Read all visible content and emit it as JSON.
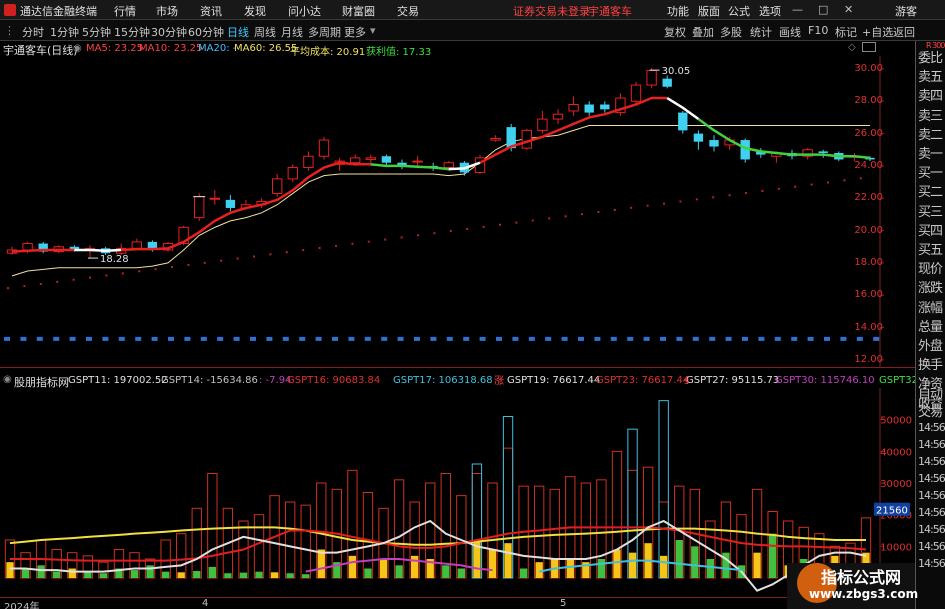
{
  "app": {
    "title": "通达信金融终端",
    "menus": [
      "行情",
      "市场",
      "资讯",
      "发现",
      "问小达",
      "财富圈",
      "交易"
    ],
    "status_msg": "证券交易未登录",
    "stock_tab": "宇通客车",
    "right_menus": [
      "功能",
      "版面",
      "公式",
      "选项"
    ],
    "user": "游客"
  },
  "toolbar": {
    "periods": [
      "分时",
      "1分钟",
      "5分钟",
      "15分钟",
      "30分钟",
      "60分钟",
      "日线",
      "周线",
      "月线",
      "多周期",
      "更多"
    ],
    "active_period": "日线",
    "right_tools": [
      "复权",
      "叠加",
      "多股",
      "统计",
      "画线",
      "F10",
      "标记",
      "+自选",
      "返回"
    ]
  },
  "main_info": {
    "stock": "宇通客车(日线)",
    "ma5": "MA5: 23.25",
    "ma10": "MA10: 23.25",
    "ma20": "MA20: -",
    "ma60": "MA60: 26.55",
    "avg_cost": "平均成本: 20.91",
    "profit": "获利值: 17.33"
  },
  "indicator_info": {
    "name": "股朋指标网",
    "items": [
      {
        "text": "GSPT11: 197002.52",
        "color": "#e0e0e0"
      },
      {
        "text": "GSPT14: -15634.86",
        "color": "#c0c0c0"
      },
      {
        "text": ": -7.94",
        "color": "#c040c0"
      },
      {
        "text": "GSPT16: 90683.84",
        "color": "#e03030"
      },
      {
        "text": "GSPT17: 106318.68",
        "color": "#40c0e0"
      },
      {
        "text": "GSPT19: 76617.44",
        "color": "#e0e0e0"
      },
      {
        "text": "GSPT23: 76617.44",
        "color": "#e03030"
      },
      {
        "text": "GSPT27: 95115.73",
        "color": "#e0e0e0"
      },
      {
        "text": "GSPT30: 115746.10",
        "color": "#c040c0"
      },
      {
        "text": "GSPT32: -",
        "color": "#40e040"
      }
    ]
  },
  "price_axis": [
    "30.00",
    "28.00",
    "26.00",
    "24.00",
    "22.00",
    "20.00",
    "18.00",
    "16.00",
    "14.00",
    "12.00"
  ],
  "vol_axis": [
    "50000",
    "40000",
    "30000",
    "20000",
    "10000"
  ],
  "vol_highlight": "21560",
  "side_times": [
    "14:56",
    "14:56",
    "14:56",
    "14:56",
    "14:56",
    "14:56",
    "14:56",
    "14:56",
    "14:56"
  ],
  "side_quote": [
    "委比",
    "卖五",
    "卖四",
    "卖三",
    "卖二",
    "卖一",
    "买一",
    "买二",
    "买三",
    "买四",
    "买五",
    "现价",
    "涨跌",
    "涨幅",
    "总量",
    "外盘",
    "换手",
    "净资",
    "收益"
  ],
  "side_bottom": [
    "自动",
    "交易"
  ],
  "side_top": "R 300",
  "annotations": {
    "high": "30.05",
    "low": "18.28",
    "zhang": "涨",
    "small": "s"
  },
  "date_axis": [
    "2024年",
    "4",
    "5"
  ],
  "watermark": {
    "title": "指标公式网",
    "url": "www.zbgs3.com"
  },
  "chart_data": {
    "type": "candlestick",
    "title": "宇通客车(日线)",
    "ylim": [
      11.5,
      30.8
    ],
    "candles": [
      {
        "o": 18.6,
        "c": 18.8,
        "h": 19.0,
        "l": 18.5
      },
      {
        "o": 18.8,
        "c": 19.2,
        "h": 19.3,
        "l": 18.6
      },
      {
        "o": 19.2,
        "c": 18.7,
        "h": 19.3,
        "l": 18.6
      },
      {
        "o": 18.7,
        "c": 19.0,
        "h": 19.1,
        "l": 18.6
      },
      {
        "o": 19.0,
        "c": 18.8,
        "h": 19.1,
        "l": 18.7
      },
      {
        "o": 18.8,
        "c": 18.9,
        "h": 19.1,
        "l": 18.3
      },
      {
        "o": 18.9,
        "c": 18.6,
        "h": 19.0,
        "l": 18.5
      },
      {
        "o": 18.6,
        "c": 18.9,
        "h": 19.2,
        "l": 18.5
      },
      {
        "o": 18.9,
        "c": 19.3,
        "h": 19.5,
        "l": 18.8
      },
      {
        "o": 19.3,
        "c": 18.8,
        "h": 19.4,
        "l": 18.7
      },
      {
        "o": 18.8,
        "c": 19.2,
        "h": 19.3,
        "l": 18.7
      },
      {
        "o": 19.2,
        "c": 20.2,
        "h": 20.3,
        "l": 19.1
      },
      {
        "o": 20.8,
        "c": 22.1,
        "h": 22.3,
        "l": 20.6
      },
      {
        "o": 22.0,
        "c": 22.0,
        "h": 22.5,
        "l": 21.6
      },
      {
        "o": 21.9,
        "c": 21.4,
        "h": 22.2,
        "l": 21.2
      },
      {
        "o": 21.4,
        "c": 21.6,
        "h": 21.9,
        "l": 21.3
      },
      {
        "o": 21.6,
        "c": 21.8,
        "h": 22.0,
        "l": 21.4
      },
      {
        "o": 22.3,
        "c": 23.2,
        "h": 23.5,
        "l": 22.1
      },
      {
        "o": 23.2,
        "c": 23.9,
        "h": 24.1,
        "l": 23.0
      },
      {
        "o": 23.9,
        "c": 24.6,
        "h": 24.9,
        "l": 23.7
      },
      {
        "o": 24.6,
        "c": 25.6,
        "h": 25.8,
        "l": 24.4
      },
      {
        "o": 24.1,
        "c": 24.3,
        "h": 24.5,
        "l": 23.7
      },
      {
        "o": 24.2,
        "c": 24.5,
        "h": 24.7,
        "l": 24.0
      },
      {
        "o": 24.4,
        "c": 24.5,
        "h": 24.7,
        "l": 24.0
      },
      {
        "o": 24.6,
        "c": 24.2,
        "h": 24.7,
        "l": 24.0
      },
      {
        "o": 24.2,
        "c": 24.0,
        "h": 24.4,
        "l": 23.8
      },
      {
        "o": 24.3,
        "c": 24.3,
        "h": 24.6,
        "l": 24.0
      },
      {
        "o": 24.0,
        "c": 23.9,
        "h": 24.2,
        "l": 23.7
      },
      {
        "o": 23.9,
        "c": 24.2,
        "h": 24.3,
        "l": 23.7
      },
      {
        "o": 24.2,
        "c": 23.6,
        "h": 24.3,
        "l": 23.4
      },
      {
        "o": 23.6,
        "c": 24.5,
        "h": 24.7,
        "l": 23.5
      },
      {
        "o": 25.6,
        "c": 25.7,
        "h": 25.9,
        "l": 25.5
      },
      {
        "o": 26.4,
        "c": 25.1,
        "h": 26.6,
        "l": 24.9
      },
      {
        "o": 25.1,
        "c": 26.2,
        "h": 26.3,
        "l": 25.0
      },
      {
        "o": 26.2,
        "c": 26.9,
        "h": 27.4,
        "l": 26.0
      },
      {
        "o": 26.9,
        "c": 27.2,
        "h": 27.5,
        "l": 26.6
      },
      {
        "o": 27.4,
        "c": 27.8,
        "h": 28.3,
        "l": 27.1
      },
      {
        "o": 27.8,
        "c": 27.3,
        "h": 28.0,
        "l": 27.1
      },
      {
        "o": 27.8,
        "c": 27.5,
        "h": 28.0,
        "l": 27.3
      },
      {
        "o": 27.3,
        "c": 28.2,
        "h": 28.5,
        "l": 27.1
      },
      {
        "o": 28.0,
        "c": 29.0,
        "h": 29.2,
        "l": 27.8
      },
      {
        "o": 29.0,
        "c": 29.9,
        "h": 30.05,
        "l": 28.8
      },
      {
        "o": 29.4,
        "c": 28.9,
        "h": 29.6,
        "l": 28.8
      },
      {
        "o": 27.3,
        "c": 26.2,
        "h": 27.4,
        "l": 26.0
      },
      {
        "o": 26.0,
        "c": 25.5,
        "h": 26.2,
        "l": 25.0
      },
      {
        "o": 25.6,
        "c": 25.2,
        "h": 25.9,
        "l": 24.9
      },
      {
        "o": 25.3,
        "c": 25.6,
        "h": 25.8,
        "l": 25.0
      },
      {
        "o": 25.6,
        "c": 24.4,
        "h": 25.7,
        "l": 24.2
      },
      {
        "o": 24.9,
        "c": 24.7,
        "h": 25.1,
        "l": 24.5
      },
      {
        "o": 24.6,
        "c": 24.8,
        "h": 24.9,
        "l": 24.2
      },
      {
        "o": 24.8,
        "c": 24.6,
        "h": 25.0,
        "l": 24.4
      },
      {
        "o": 24.6,
        "c": 25.0,
        "h": 25.1,
        "l": 24.4
      },
      {
        "o": 24.9,
        "c": 24.8,
        "h": 25.0,
        "l": 24.5
      },
      {
        "o": 24.8,
        "c": 24.4,
        "h": 24.9,
        "l": 24.3
      },
      {
        "o": 24.6,
        "c": 24.6,
        "h": 24.8,
        "l": 24.3
      },
      {
        "o": 24.5,
        "c": 24.4,
        "h": 24.6,
        "l": 24.3
      }
    ],
    "ma_line": [
      18.7,
      18.75,
      18.8,
      18.8,
      18.8,
      18.8,
      18.75,
      18.8,
      18.85,
      18.85,
      18.9,
      19.3,
      19.9,
      20.6,
      21.1,
      21.4,
      21.6,
      21.9,
      22.5,
      23.3,
      23.9,
      24.2,
      24.1,
      24.1,
      24.0,
      24.0,
      23.95,
      23.9,
      23.8,
      23.85,
      24.2,
      24.7,
      25.2,
      25.5,
      25.8,
      26.2,
      26.6,
      27.0,
      27.2,
      27.5,
      27.8,
      28.2,
      28.2,
      27.6,
      26.9,
      26.2,
      25.6,
      25.1,
      24.9,
      24.8,
      24.7,
      24.7,
      24.7,
      24.6,
      24.6,
      24.5
    ],
    "ma_color_segments": [
      {
        "from": 0,
        "to": 4,
        "color": "#e82020"
      },
      {
        "from": 4,
        "to": 7,
        "color": "#ffffff"
      },
      {
        "from": 7,
        "to": 23,
        "color": "#e82020"
      },
      {
        "from": 23,
        "to": 28,
        "color": "#40d040"
      },
      {
        "from": 28,
        "to": 30,
        "color": "#ffffff"
      },
      {
        "from": 30,
        "to": 42,
        "color": "#e82020"
      },
      {
        "from": 42,
        "to": 44,
        "color": "#ffffff"
      },
      {
        "from": 44,
        "to": 55,
        "color": "#40d040"
      }
    ],
    "cost_line": [
      17.2,
      17.5,
      17.6,
      17.7,
      17.7,
      17.7,
      17.7,
      17.7,
      17.7,
      17.8,
      18.0,
      18.8,
      19.7,
      20.2,
      20.6,
      20.8,
      21.1,
      21.6,
      22.3,
      23.0,
      23.4,
      23.5,
      23.5,
      23.5,
      23.5,
      23.5,
      23.5,
      23.5,
      23.4,
      23.5,
      24.2,
      25.0,
      25.5,
      25.7,
      25.8,
      25.9,
      26.2,
      26.5,
      26.5,
      26.5,
      26.5,
      26.5,
      26.5,
      26.5,
      26.5,
      26.5,
      26.5,
      26.5,
      26.5,
      26.5,
      26.5,
      26.5,
      26.5,
      26.5,
      26.5,
      26.5
    ],
    "dot_trend": [
      16.5,
      23.3
    ],
    "blue_bar_level": 13.3,
    "volume": {
      "ylim": [
        -6000,
        60000
      ],
      "red_outline": [
        12000,
        8000,
        12000,
        9000,
        8000,
        7000,
        5000,
        9000,
        8000,
        6000,
        12000,
        14000,
        22000,
        33000,
        22000,
        18000,
        20000,
        26000,
        24000,
        23000,
        30000,
        28000,
        34000,
        27000,
        22000,
        31000,
        24000,
        30000,
        33000,
        26000,
        33000,
        30000,
        41000,
        29000,
        29000,
        28000,
        32000,
        30000,
        31000,
        40000,
        34000,
        35000,
        24000,
        29000,
        28000,
        18000,
        24000,
        20000,
        28000,
        21000,
        18000,
        16000,
        14000,
        10000,
        11000,
        19000
      ],
      "cyan_outline": [
        0,
        0,
        0,
        0,
        0,
        0,
        0,
        0,
        0,
        0,
        0,
        0,
        0,
        0,
        0,
        0,
        0,
        0,
        0,
        0,
        0,
        0,
        0,
        0,
        0,
        0,
        0,
        0,
        0,
        0,
        36000,
        0,
        51000,
        0,
        0,
        0,
        0,
        0,
        0,
        0,
        47000,
        0,
        56000,
        0,
        0,
        0,
        0,
        0,
        0,
        0,
        0,
        0,
        0,
        0,
        0,
        0
      ],
      "solid_bars": [
        {
          "v": 5000,
          "c": "#f5c518"
        },
        {
          "v": 3000,
          "c": "#40c040"
        },
        {
          "v": 4000,
          "c": "#40c040"
        },
        {
          "v": 2000,
          "c": "#40c040"
        },
        {
          "v": 3000,
          "c": "#f5c518"
        },
        {
          "v": 2000,
          "c": "#40c040"
        },
        {
          "v": 1500,
          "c": "#40c040"
        },
        {
          "v": 3000,
          "c": "#40c040"
        },
        {
          "v": 2500,
          "c": "#40c040"
        },
        {
          "v": 4000,
          "c": "#40c040"
        },
        {
          "v": 2000,
          "c": "#40c040"
        },
        {
          "v": 1800,
          "c": "#f5c518"
        },
        {
          "v": 2200,
          "c": "#40c040"
        },
        {
          "v": 3500,
          "c": "#40c040"
        },
        {
          "v": 1500,
          "c": "#40c040"
        },
        {
          "v": 1700,
          "c": "#40c040"
        },
        {
          "v": 2000,
          "c": "#40c040"
        },
        {
          "v": 1800,
          "c": "#f5c518"
        },
        {
          "v": 1500,
          "c": "#40c040"
        },
        {
          "v": 1200,
          "c": "#40c040"
        },
        {
          "v": 9000,
          "c": "#f5c518"
        },
        {
          "v": 5000,
          "c": "#40c040"
        },
        {
          "v": 7000,
          "c": "#f5c518"
        },
        {
          "v": 3000,
          "c": "#40c040"
        },
        {
          "v": 6000,
          "c": "#f5c518"
        },
        {
          "v": 4000,
          "c": "#40c040"
        },
        {
          "v": 7000,
          "c": "#f5c518"
        },
        {
          "v": 6000,
          "c": "#f5c518"
        },
        {
          "v": 4000,
          "c": "#40c040"
        },
        {
          "v": 3000,
          "c": "#40c040"
        },
        {
          "v": 12000,
          "c": "#f5c518"
        },
        {
          "v": 9000,
          "c": "#f5c518"
        },
        {
          "v": 11000,
          "c": "#f5c518"
        },
        {
          "v": 3000,
          "c": "#40c040"
        },
        {
          "v": 5000,
          "c": "#f5c518"
        },
        {
          "v": 6000,
          "c": "#f5c518"
        },
        {
          "v": 6000,
          "c": "#f5c518"
        },
        {
          "v": 5000,
          "c": "#f5c518"
        },
        {
          "v": 6000,
          "c": "#40c040"
        },
        {
          "v": 9000,
          "c": "#f5c518"
        },
        {
          "v": 8000,
          "c": "#f5c518"
        },
        {
          "v": 11000,
          "c": "#f5c518"
        },
        {
          "v": 7000,
          "c": "#f5c518"
        },
        {
          "v": 12000,
          "c": "#40c040"
        },
        {
          "v": 10000,
          "c": "#40c040"
        },
        {
          "v": 6000,
          "c": "#40c040"
        },
        {
          "v": 8000,
          "c": "#40c040"
        },
        {
          "v": 4000,
          "c": "#40c040"
        },
        {
          "v": 8000,
          "c": "#f5c518"
        },
        {
          "v": 14000,
          "c": "#40c040"
        },
        {
          "v": 4000,
          "c": "#f5c518"
        },
        {
          "v": 6000,
          "c": "#40c040"
        },
        {
          "v": 3000,
          "c": "#40c040"
        },
        {
          "v": 7000,
          "c": "#f5c518"
        },
        {
          "v": 3000,
          "c": "#40c040"
        },
        {
          "v": 8000,
          "c": "#f5c518"
        }
      ],
      "yellow_line": [
        11000,
        11500,
        12000,
        12300,
        12600,
        13000,
        13300,
        13600,
        14000,
        14300,
        14600,
        15000,
        15300,
        15600,
        15800,
        16000,
        16000,
        16000,
        15600,
        15000,
        14000,
        13000,
        12000,
        11500,
        11000,
        10800,
        10500,
        10500,
        10800,
        11000,
        11500,
        12000,
        12500,
        13000,
        13300,
        13600,
        13800,
        14000,
        14300,
        14600,
        15000,
        15300,
        15600,
        15600,
        15600,
        15300,
        15000,
        14600,
        14000,
        13600,
        13000,
        12600,
        12300,
        12000,
        12000,
        12000
      ],
      "red_line": [
        6000,
        6000,
        6000,
        5800,
        5600,
        5500,
        5500,
        5500,
        5500,
        5500,
        5500,
        5800,
        6200,
        7000,
        8000,
        9000,
        11000,
        13000,
        15000,
        15000,
        14600,
        14000,
        13000,
        12000,
        11000,
        10000,
        9500,
        9500,
        10000,
        11000,
        12000,
        13000,
        14000,
        14600,
        15000,
        15500,
        16000,
        16000,
        16000,
        16000,
        16000,
        16000,
        15600,
        15000,
        14000,
        13000,
        12000,
        11000,
        10500,
        10200,
        10000,
        10000,
        9800,
        9600,
        9400,
        9000
      ],
      "white_line": [
        3000,
        3000,
        2500,
        2500,
        2000,
        2000,
        2000,
        2500,
        3000,
        3000,
        3500,
        4000,
        6000,
        9000,
        11000,
        13000,
        12000,
        11000,
        10000,
        9000,
        8000,
        8000,
        9000,
        10000,
        11000,
        13000,
        16000,
        18000,
        14000,
        12000,
        10000,
        9000,
        8000,
        7000,
        6500,
        6000,
        6000,
        6000,
        7000,
        9000,
        12000,
        16000,
        18000,
        15000,
        12000,
        9000,
        6000,
        2000,
        -4000,
        -2000,
        1000,
        4000,
        7000,
        8000,
        8000,
        7000
      ],
      "magenta_line": [
        0,
        0,
        0,
        0,
        0,
        0,
        0,
        0,
        0,
        0,
        0,
        0,
        0,
        0,
        0,
        0,
        0,
        0,
        0,
        2000,
        3000,
        4000,
        5000,
        5500,
        6000,
        6000,
        5500,
        5000,
        4500,
        4000,
        3000,
        2500,
        0,
        0,
        0,
        0,
        0,
        0,
        0,
        0,
        0,
        0,
        0,
        0,
        0,
        0,
        0,
        0,
        0,
        0,
        0,
        0,
        0,
        0,
        0,
        0
      ],
      "cyan_line": [
        0,
        0,
        0,
        0,
        0,
        0,
        0,
        0,
        0,
        0,
        0,
        0,
        0,
        0,
        0,
        0,
        0,
        0,
        0,
        0,
        0,
        0,
        0,
        0,
        0,
        0,
        0,
        0,
        0,
        0,
        0,
        0,
        0,
        0,
        2000,
        3000,
        3500,
        4000,
        4500,
        5000,
        5500,
        5500,
        5000,
        4500,
        4000,
        3500,
        3000,
        2500,
        0,
        0,
        0,
        0,
        0,
        0,
        0,
        0
      ]
    }
  }
}
